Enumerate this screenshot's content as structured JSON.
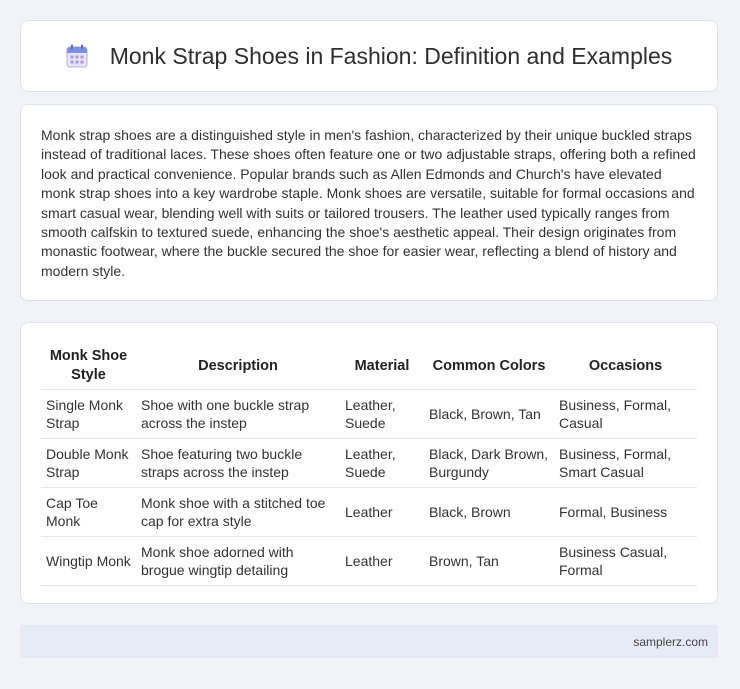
{
  "header": {
    "title": "Monk Strap Shoes in Fashion: Definition and Examples",
    "icon": "calendar-icon"
  },
  "intro": {
    "text": "Monk strap shoes are a distinguished style in men's fashion, characterized by their unique buckled straps instead of traditional laces. These shoes often feature one or two adjustable straps, offering both a refined look and practical convenience. Popular brands such as Allen Edmonds and Church's have elevated monk strap shoes into a key wardrobe staple. Monk shoes are versatile, suitable for formal occasions and smart casual wear, blending well with suits or tailored trousers. The leather used typically ranges from smooth calfskin to textured suede, enhancing the shoe's aesthetic appeal. Their design originates from monastic footwear, where the buckle secured the shoe for easier wear, reflecting a blend of history and modern style."
  },
  "table": {
    "headers": [
      "Monk Shoe Style",
      "Description",
      "Material",
      "Common Colors",
      "Occasions"
    ],
    "rows": [
      [
        "Single Monk Strap",
        "Shoe with one buckle strap across the instep",
        "Leather, Suede",
        "Black, Brown, Tan",
        "Business, Formal, Casual"
      ],
      [
        "Double Monk Strap",
        "Shoe featuring two buckle straps across the instep",
        "Leather, Suede",
        "Black, Dark Brown, Burgundy",
        "Business, Formal, Smart Casual"
      ],
      [
        "Cap Toe Monk",
        "Monk shoe with a stitched toe cap for extra style",
        "Leather",
        "Black, Brown",
        "Formal, Business"
      ],
      [
        "Wingtip Monk",
        "Monk shoe adorned with brogue wingtip detailing",
        "Leather",
        "Brown, Tan",
        "Business Casual, Formal"
      ]
    ]
  },
  "footer": {
    "source": "samplerz.com"
  }
}
